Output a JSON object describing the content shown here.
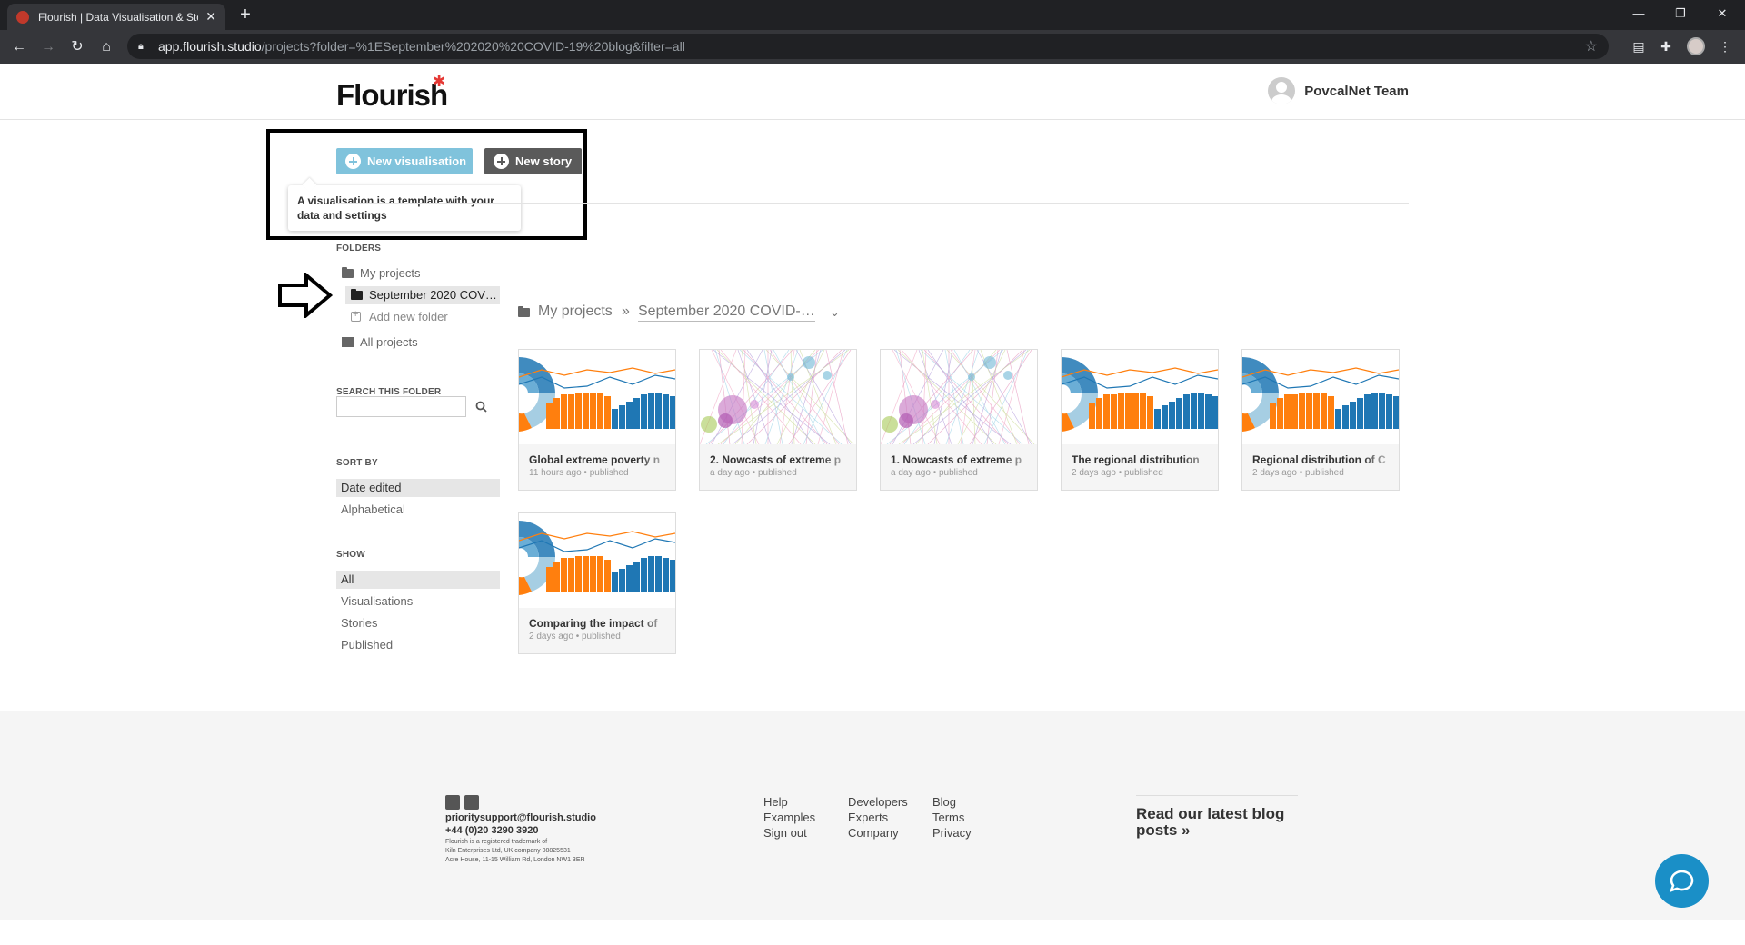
{
  "browser": {
    "tab_title": "Flourish | Data Visualisation & Sto",
    "tab_close": "✕",
    "new_tab": "+",
    "url_host": "app.flourish.studio",
    "url_path": "/projects?folder=%1ESeptember%202020%20COVID-19%20blog&filter=all",
    "win_min": "—",
    "win_restore": "❐",
    "win_close": "✕"
  },
  "header": {
    "logo": "Flourish",
    "user_name": "PovcalNet Team"
  },
  "actions": {
    "new_vis": "New visualisation",
    "new_story": "New story",
    "tooltip": "A visualisation is a template with your data and settings"
  },
  "sidebar": {
    "folders_label": "FOLDERS",
    "my_projects": "My projects",
    "current_folder": "September 2020 COV…",
    "add_folder": "Add new folder",
    "all_projects": "All projects",
    "search_label": "SEARCH THIS FOLDER",
    "sort_label": "SORT BY",
    "sort_options": [
      "Date edited",
      "Alphabetical"
    ],
    "show_label": "SHOW",
    "show_options": [
      "All",
      "Visualisations",
      "Stories",
      "Published"
    ]
  },
  "breadcrumb": {
    "root": "My projects",
    "separator": "»",
    "current": "September 2020 COVID-…"
  },
  "cards": [
    {
      "title": "Global extreme poverty n",
      "meta": "11 hours ago • published",
      "thumb": "bars"
    },
    {
      "title": "2. Nowcasts of extreme p",
      "meta": "a day ago • published",
      "thumb": "scatter"
    },
    {
      "title": "1. Nowcasts of extreme p",
      "meta": "a day ago • published",
      "thumb": "scatter"
    },
    {
      "title": "The regional distribution",
      "meta": "2 days ago • published",
      "thumb": "bars"
    },
    {
      "title": "Regional distribution of C",
      "meta": "2 days ago • published",
      "thumb": "bars"
    },
    {
      "title": "Comparing the impact of",
      "meta": "2 days ago • published",
      "thumb": "bars"
    }
  ],
  "footer": {
    "email": "prioritysupport@flourish.studio",
    "phone": "+44 (0)20 3290 3920",
    "legal1": "Flourish is a registered trademark of",
    "legal2": "Kiln Enterprises Ltd, UK company 08825531",
    "legal3": "Acre House, 11-15 William Rd, London NW1 3ER",
    "col1": [
      "Help",
      "Examples",
      "Sign out"
    ],
    "col2": [
      "Developers",
      "Experts",
      "Company"
    ],
    "col3": [
      "Blog",
      "Terms",
      "Privacy"
    ],
    "blog_cta": "Read our latest blog posts »"
  },
  "colors": {
    "accent_blue": "#80c3dc",
    "dark_button": "#5a5a5a",
    "logo_star": "#e53935",
    "chat": "#1a8fc7"
  }
}
